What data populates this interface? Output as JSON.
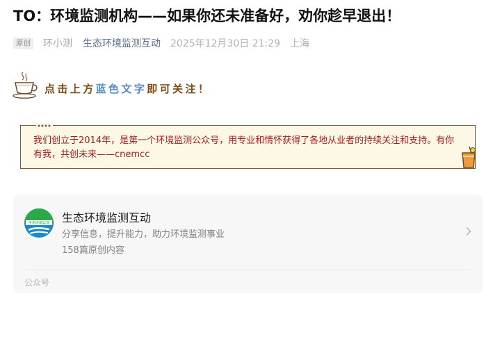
{
  "article": {
    "title": "TO：环境监测机构——如果你还未准备好，劝你趁早退出！",
    "badge": "原创",
    "author": "环小测",
    "account": "生态环境监测互动",
    "date": "2025年12月30日 21:29",
    "location": "上海"
  },
  "follow_banner": {
    "part1": "点击上方",
    "part2": "蓝色文字",
    "part3": "即可关注！",
    "colors": {
      "brown": "#7b4a17",
      "blue": "#5a8ac8"
    },
    "icon": "coffee-cup-icon"
  },
  "notice": {
    "text": "我们创立于2014年，是第一个环境监测公众号，用专业和情怀获得了各地从业者的持续关注和支持。有你有我，共创未来——cnemcc",
    "text_color": "#9e1d1d",
    "icon": "juice-glass-icon"
  },
  "account_card": {
    "name": "生态环境监测互动",
    "description": "分享信息，提升能力，助力环境监测事业",
    "article_count": "158篇原创内容",
    "type_label": "公众号",
    "logo_text": "生态环境监测",
    "logo_colors": {
      "green": "#2aa84a",
      "blue": "#1a88c9"
    },
    "chevron_icon": "chevron-right-icon"
  }
}
